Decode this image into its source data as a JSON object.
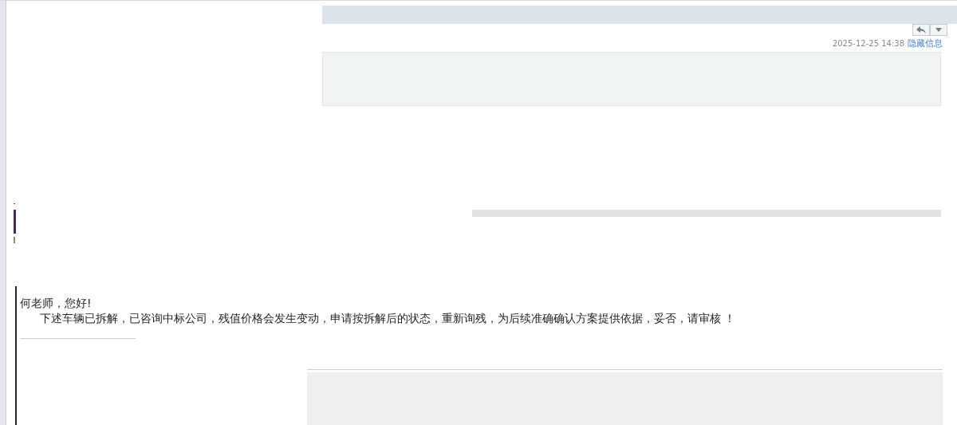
{
  "message": {
    "date": "2025-12-25 14:38",
    "hide_link": "隐藏信息"
  },
  "body": {
    "greeting": "何老师，您好!",
    "paragraph": "下述车辆已拆解，已咨询中标公司，残值价格会发生变动，申请按拆解后的状态，重新询残，为后续准确确认方案提供依据，妥否，请审核 ！"
  }
}
